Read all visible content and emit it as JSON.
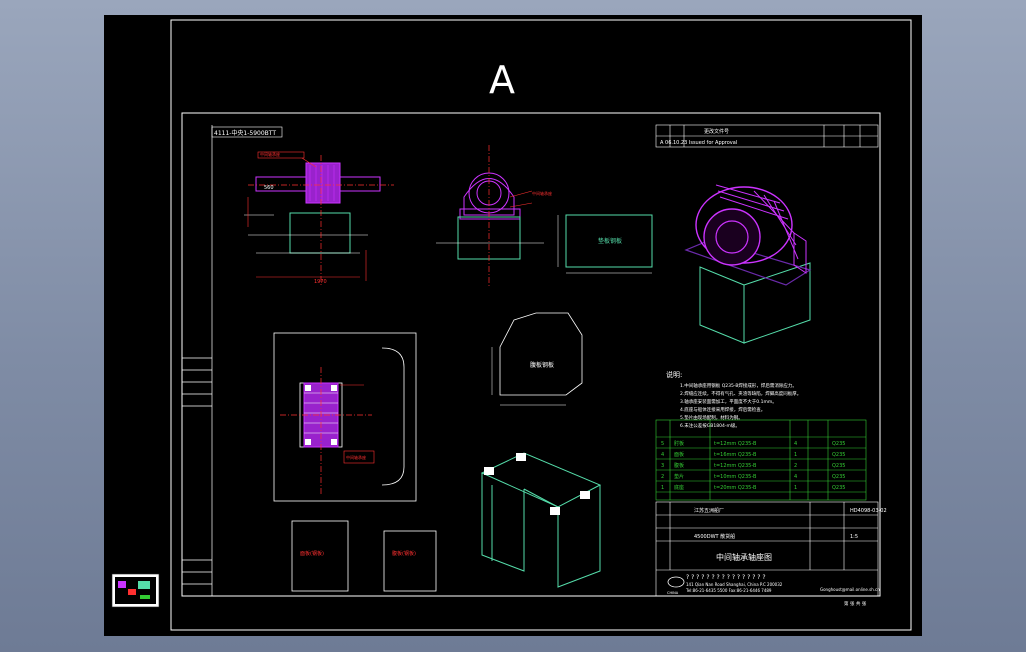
{
  "sheet": {
    "letter": "A"
  },
  "title_block": {
    "part_name": "中间轴承轴座图",
    "company_line": "? ? ? ? ? ? ? ? ? ? ? ? ? ? ? ?",
    "address_line": "141 Qian Nan Road Shanghai, China P.C 200032",
    "phone_line": "Tel:86-21-6435 5500 Fax:86-21-6446 7489",
    "email_line": "Gonghoust@mail.online.sh.cn",
    "logo_text": "CHINA",
    "drawing_no": "HD4098-03-02",
    "scale": "1:5",
    "page": "第 张 共 张",
    "factory": "江苏五洲船厂",
    "project": "4500DWT 散货船",
    "revision_row": "A   06.10.23   Issued for Approval",
    "header_cells": [
      "标记",
      "处数",
      "更改文件号",
      "签字",
      "日期"
    ]
  },
  "header_label": "4111-中央1-5900BTT",
  "notes": {
    "title": "说明:",
    "lines": [
      "1.中间轴承座用钢板 Q235-B焊接成形，焊后需消除应力。",
      "2.焊缝应连续，不得有气孔、夹渣等缺陷，焊脚高度同板厚。",
      "3.轴承座安装面需加工，平面度不大于0.1mm。",
      "4.底座与船体连接采用焊接，焊后需检查。",
      "5.垫片由现场配制，材料为钢。",
      "6.未注公差按GB1804-m级。"
    ]
  },
  "bom": {
    "rows": [
      {
        "no": "5",
        "name": "肘板",
        "spec": "t=12mm  Q235-B",
        "qty": "4",
        "material": "Q235"
      },
      {
        "no": "4",
        "name": "面板",
        "spec": "t=16mm  Q235-B",
        "qty": "1",
        "material": "Q235"
      },
      {
        "no": "3",
        "name": "腹板",
        "spec": "t=12mm  Q235-B",
        "qty": "2",
        "material": "Q235"
      },
      {
        "no": "2",
        "name": "垫片",
        "spec": "t=10mm  Q235-B",
        "qty": "4",
        "material": "Q235"
      },
      {
        "no": "1",
        "name": "底座",
        "spec": "t=20mm  Q235-B",
        "qty": "1",
        "material": "Q235"
      }
    ]
  },
  "labels": {
    "plate_front": "垫板钢板",
    "plate_right": "面板钢板",
    "plate_top": "腹板钢板",
    "small_1": "面板(钢板)",
    "small_2": "腹板(钢板)",
    "callout_side": "中间轴承座",
    "callout_plan": "中间轴承座"
  },
  "dims": {
    "d1": "1970",
    "d2": "900",
    "d3": "650",
    "d4": "1500",
    "d5": "700",
    "d6": "350",
    "d7": "280",
    "d8": "96",
    "d9": "560",
    "d10": "180"
  },
  "colors": {
    "bg": "#000000",
    "frame": "#ffffff",
    "magenta": "#cc33ff",
    "green": "#55ddaa",
    "red": "#ff3030",
    "yellow": "#ffff40",
    "cyan": "#66eeff",
    "bom_green": "#33cc33"
  },
  "thumbnail": {
    "icon": "drawing-thumbnail-icon"
  }
}
